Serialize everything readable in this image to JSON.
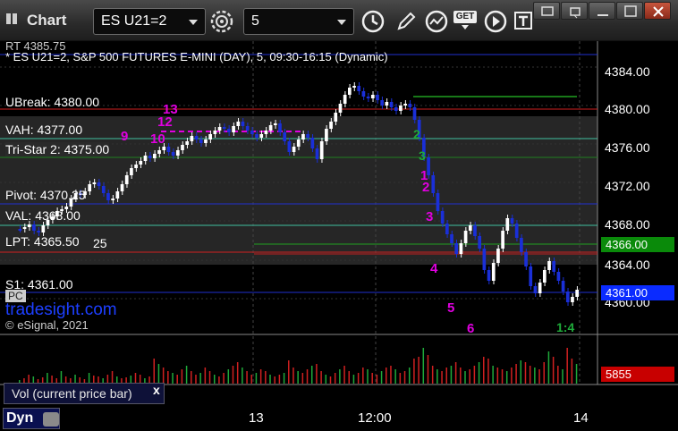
{
  "window": {
    "title": "Chart",
    "symbol": "ES U21=2",
    "interval": "5",
    "get_label": "GET"
  },
  "chart": {
    "partial_top_label": "RT 4385.75",
    "header": "* ES U21=2, S&P 500 FUTURES E-MINI (DAY), 5, 09:30-16:15 (Dynamic)",
    "watermark": "tradesight.com",
    "copyright": "© eSignal, 2021",
    "pc_label": "PC",
    "y_axis": [
      "4384.00",
      "4380.00",
      "4376.00",
      "4372.00",
      "4368.00",
      "4364.00",
      "4360.00"
    ],
    "current_price": "4361.00",
    "level_price": "4366.00",
    "volume_value": "5855",
    "levels": [
      {
        "label": "UBreak: 4380.00",
        "color": "#d02020"
      },
      {
        "label": "VAH: 4377.00",
        "color": "#40c0a0"
      },
      {
        "label": "Tri-Star 2: 4375.00",
        "color": "#208020"
      },
      {
        "label": "Pivot: 4370.25",
        "color": "#2030d0"
      },
      {
        "label": "VAL: 4368.00",
        "color": "#40c0a0"
      },
      {
        "label": "LPT: 4365.50",
        "color": "#d02020"
      },
      {
        "label": "S1: 4361.00",
        "color": "#2030d0"
      }
    ],
    "extra_label": "25",
    "fib_labels": [
      "13",
      "12",
      "10",
      "9",
      "1",
      "2",
      "3",
      "4",
      "5",
      "6"
    ],
    "green_labels": [
      "2",
      "3",
      "1:4"
    ],
    "colors": {
      "up_candle": "#ffffff",
      "down_candle": "#1a2fd8",
      "sell_candle": "#1a2fd8",
      "volume": "#d02020",
      "price_box_blue": "#0a2bff",
      "price_box_green": "#0a8a0a",
      "volume_box": "#c80000"
    }
  },
  "volume_panel": {
    "legend": "Vol (current price bar)",
    "close_icon": "x"
  },
  "time_axis": {
    "dyn_label": "Dyn",
    "labels": [
      "13",
      "12:00",
      "14"
    ]
  }
}
